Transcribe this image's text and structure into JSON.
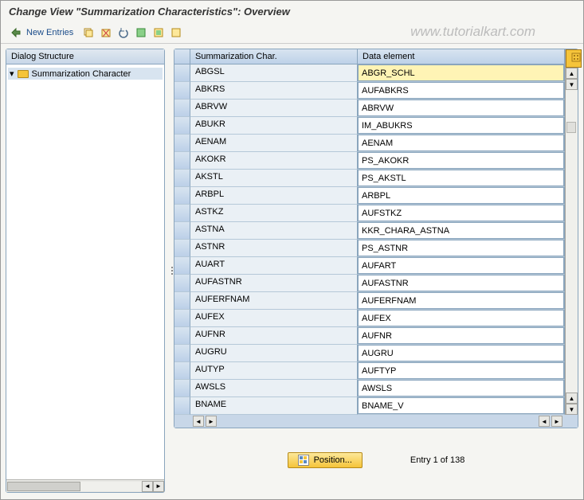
{
  "title": "Change View \"Summarization Characteristics\": Overview",
  "watermark": "www.tutorialkart.com",
  "toolbar": {
    "new_entries_label": "New Entries"
  },
  "sidebar": {
    "header": "Dialog Structure",
    "tree_item": "Summarization Character"
  },
  "table": {
    "col1_header": "Summarization Char.",
    "col2_header": "Data element",
    "rows": [
      {
        "c1": "ABGSL",
        "c2": "ABGR_SCHL",
        "selected": true
      },
      {
        "c1": "ABKRS",
        "c2": "AUFABKRS"
      },
      {
        "c1": "ABRVW",
        "c2": "ABRVW"
      },
      {
        "c1": "ABUKR",
        "c2": "IM_ABUKRS"
      },
      {
        "c1": "AENAM",
        "c2": "AENAM"
      },
      {
        "c1": "AKOKR",
        "c2": "PS_AKOKR"
      },
      {
        "c1": "AKSTL",
        "c2": "PS_AKSTL"
      },
      {
        "c1": "ARBPL",
        "c2": "ARBPL"
      },
      {
        "c1": "ASTKZ",
        "c2": "AUFSTKZ"
      },
      {
        "c1": "ASTNA",
        "c2": "KKR_CHARA_ASTNA"
      },
      {
        "c1": "ASTNR",
        "c2": "PS_ASTNR"
      },
      {
        "c1": "AUART",
        "c2": "AUFART"
      },
      {
        "c1": "AUFASTNR",
        "c2": "AUFASTNR"
      },
      {
        "c1": "AUFERFNAM",
        "c2": "AUFERFNAM"
      },
      {
        "c1": "AUFEX",
        "c2": "AUFEX"
      },
      {
        "c1": "AUFNR",
        "c2": "AUFNR"
      },
      {
        "c1": "AUGRU",
        "c2": "AUGRU"
      },
      {
        "c1": "AUTYP",
        "c2": "AUFTYP"
      },
      {
        "c1": "AWSLS",
        "c2": "AWSLS"
      },
      {
        "c1": "BNAME",
        "c2": "BNAME_V"
      }
    ]
  },
  "footer": {
    "position_label": "Position...",
    "entry_text": "Entry 1 of 138"
  }
}
